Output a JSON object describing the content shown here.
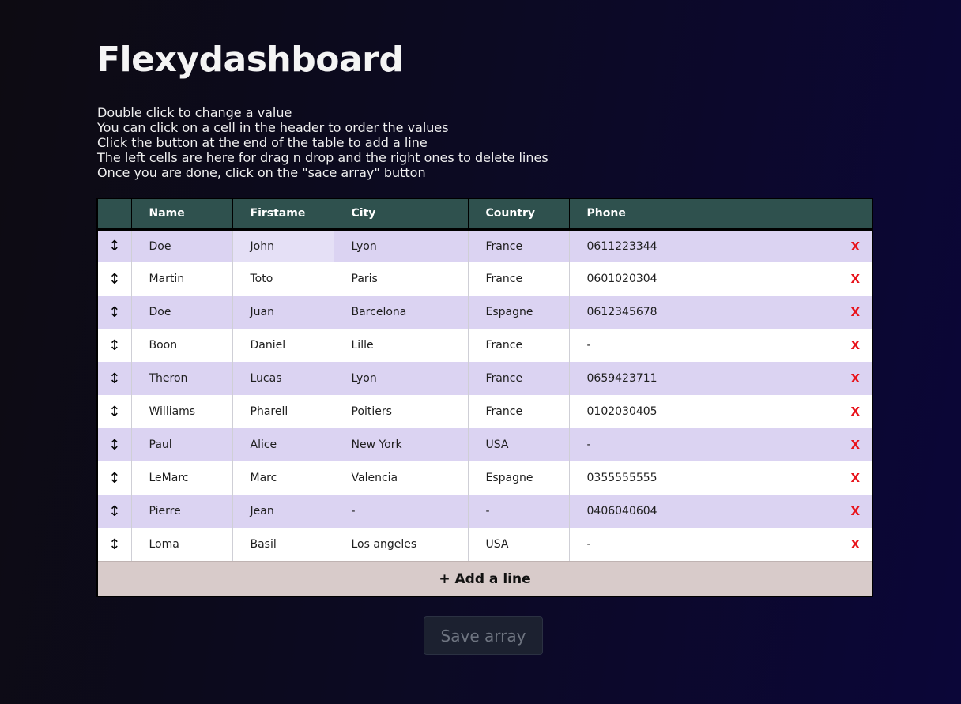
{
  "page": {
    "title": "Flexydashboard"
  },
  "instructions": [
    "Double click to change a value",
    "You can click on a cell in the header to order the values",
    "Click the button at the end of the table to add a line",
    "The left cells are here for drag n drop and the right ones to delete lines",
    "Once you are done, click on the \"sace array\" button"
  ],
  "table": {
    "headers": [
      "",
      "Name",
      "Firstame",
      "City",
      "Country",
      "Phone",
      ""
    ],
    "drag_icon": "↕",
    "delete_icon": "X",
    "rows": [
      [
        "Doe",
        "John",
        "Lyon",
        "France",
        "0611223344"
      ],
      [
        "Martin",
        "Toto",
        "Paris",
        "France",
        "0601020304"
      ],
      [
        "Doe",
        "Juan",
        "Barcelona",
        "Espagne",
        "0612345678"
      ],
      [
        "Boon",
        "Daniel",
        "Lille",
        "France",
        "-"
      ],
      [
        "Theron",
        "Lucas",
        "Lyon",
        "France",
        "0659423711"
      ],
      [
        "Williams",
        "Pharell",
        "Poitiers",
        "France",
        "0102030405"
      ],
      [
        "Paul",
        "Alice",
        "New York",
        "USA",
        "-"
      ],
      [
        "LeMarc",
        "Marc",
        "Valencia",
        "Espagne",
        "0355555555"
      ],
      [
        "Pierre",
        "Jean",
        "-",
        "-",
        "0406040604"
      ],
      [
        "Loma",
        "Basil",
        "Los angeles",
        "USA",
        "-"
      ]
    ],
    "add_line_label": "+ Add a line"
  },
  "save_button": {
    "label": "Save array"
  },
  "colors": {
    "header_bg": "#2f514e",
    "row_odd": "#dbd3f2",
    "row_even": "#ffffff",
    "delete": "#e8141c",
    "add_line_bg": "#d8cbca"
  }
}
